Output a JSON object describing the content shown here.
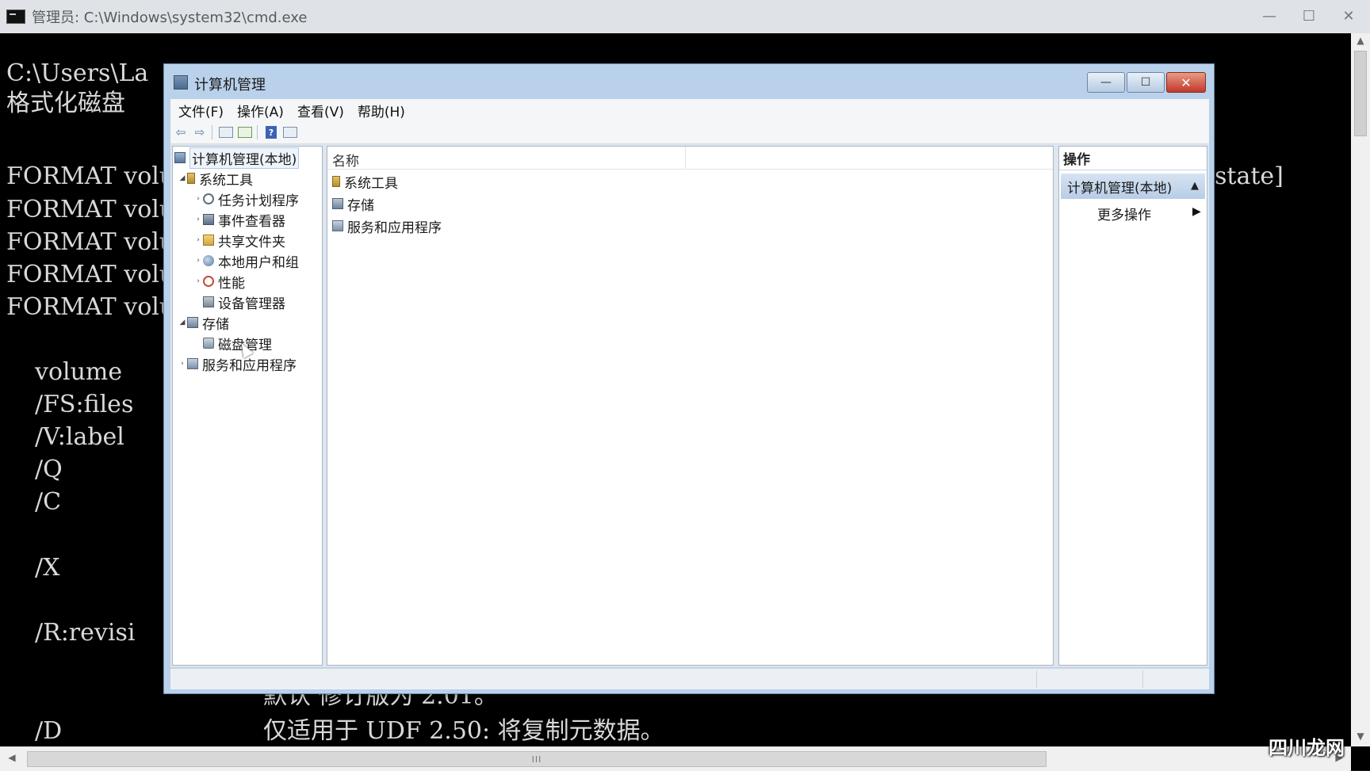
{
  "cmd": {
    "title": "管理员: C:\\Windows\\system32\\cmd.exe",
    "controls": {
      "minimize": "—",
      "maximize": "☐",
      "close": "✕"
    },
    "lines": [
      "C:\\Users\\La",
      "格式化磁盘",
      "FORMAT volu",
      "FORMAT volu",
      "FORMAT volu",
      "FORMAT volu",
      "FORMAT volu",
      "volume",
      "/FS:files",
      "/V:label",
      "/Q",
      "/C",
      "/X",
      "/R:revisi",
      "/D"
    ],
    "right_fragment": "state]",
    "bottom_line_partial": "默认 修订版为 2.01。",
    "bottom_line": "仅适用于 UDF 2.50: 将复制元数据。",
    "hscroll_grip": "III"
  },
  "cm": {
    "title": "计算机管理",
    "controls": {
      "minimize": "—",
      "maximize": "☐",
      "close": "✕"
    },
    "menu": [
      "文件(F)",
      "操作(A)",
      "查看(V)",
      "帮助(H)"
    ],
    "toolbar": {
      "back": "⇦",
      "forward": "⇨",
      "help": "?"
    },
    "tree": [
      {
        "label": "计算机管理(本地)",
        "toggle": "",
        "icon": "computer-icon"
      },
      {
        "label": "系统工具",
        "toggle": "◢",
        "icon": "tools-icon"
      },
      {
        "label": "任务计划程序",
        "toggle": "›",
        "icon": "clock-icon"
      },
      {
        "label": "事件查看器",
        "toggle": "›",
        "icon": "event-viewer-icon"
      },
      {
        "label": "共享文件夹",
        "toggle": "›",
        "icon": "shared-folder-icon"
      },
      {
        "label": "本地用户和组",
        "toggle": "›",
        "icon": "users-icon"
      },
      {
        "label": "性能",
        "toggle": "›",
        "icon": "performance-icon"
      },
      {
        "label": "设备管理器",
        "toggle": "",
        "icon": "device-manager-icon"
      },
      {
        "label": "存储",
        "toggle": "◢",
        "icon": "storage-icon"
      },
      {
        "label": "磁盘管理",
        "toggle": "",
        "icon": "disk-icon"
      },
      {
        "label": "服务和应用程序",
        "toggle": "›",
        "icon": "services-icon"
      }
    ],
    "list": {
      "header": "名称",
      "rows": [
        {
          "label": "系统工具",
          "icon": "tools-icon"
        },
        {
          "label": "存储",
          "icon": "storage-icon"
        },
        {
          "label": "服务和应用程序",
          "icon": "services-icon"
        }
      ]
    },
    "actions": {
      "title": "操作",
      "section": "计算机管理(本地)",
      "collapse": "▲",
      "more": "更多操作",
      "more_arrow": "▶"
    }
  },
  "watermark": "四川龙网"
}
